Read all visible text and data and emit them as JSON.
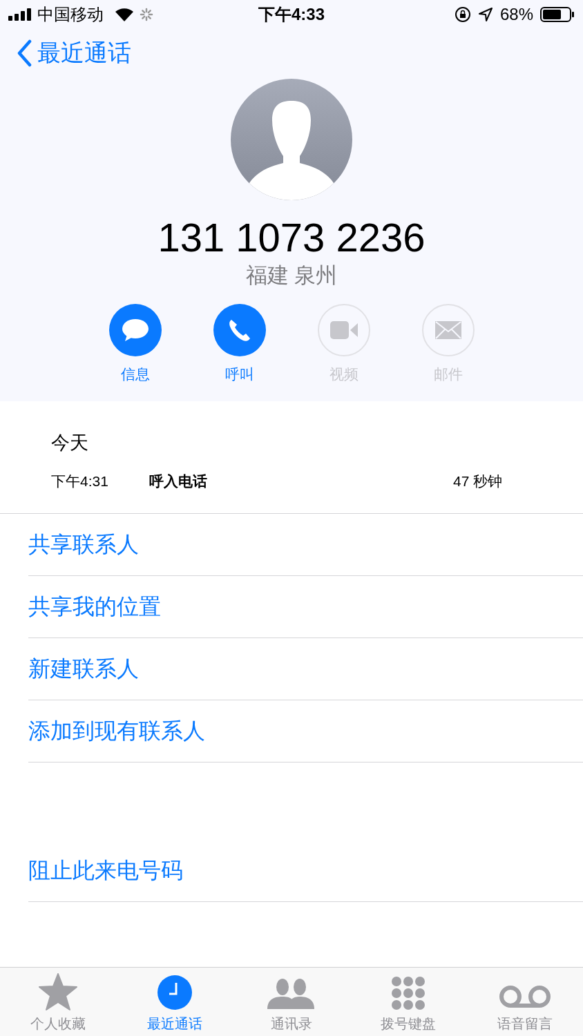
{
  "status_bar": {
    "carrier": "中国移动",
    "time": "下午4:33",
    "battery": "68%"
  },
  "nav": {
    "back_label": "最近通话"
  },
  "contact": {
    "number": "131 1073 2236",
    "location": "福建 泉州"
  },
  "actions": [
    {
      "kind": "message",
      "label": "信息",
      "disabled": false
    },
    {
      "kind": "phone",
      "label": "呼叫",
      "disabled": false
    },
    {
      "kind": "video",
      "label": "视频",
      "disabled": true
    },
    {
      "kind": "mail",
      "label": "邮件",
      "disabled": true
    }
  ],
  "call_log": {
    "date": "今天",
    "entries": [
      {
        "time": "下午4:31",
        "type": "呼入电话",
        "duration": "47 秒钟"
      }
    ]
  },
  "menu": [
    "共享联系人",
    "共享我的位置",
    "新建联系人",
    "添加到现有联系人"
  ],
  "block_action": "阻止此来电号码",
  "tabs": [
    {
      "kind": "favorites",
      "label": "个人收藏",
      "selected": false
    },
    {
      "kind": "recents",
      "label": "最近通话",
      "selected": true
    },
    {
      "kind": "contacts",
      "label": "通讯录",
      "selected": false
    },
    {
      "kind": "keypad",
      "label": "拨号键盘",
      "selected": false
    },
    {
      "kind": "voicemail",
      "label": "语音留言",
      "selected": false
    }
  ]
}
